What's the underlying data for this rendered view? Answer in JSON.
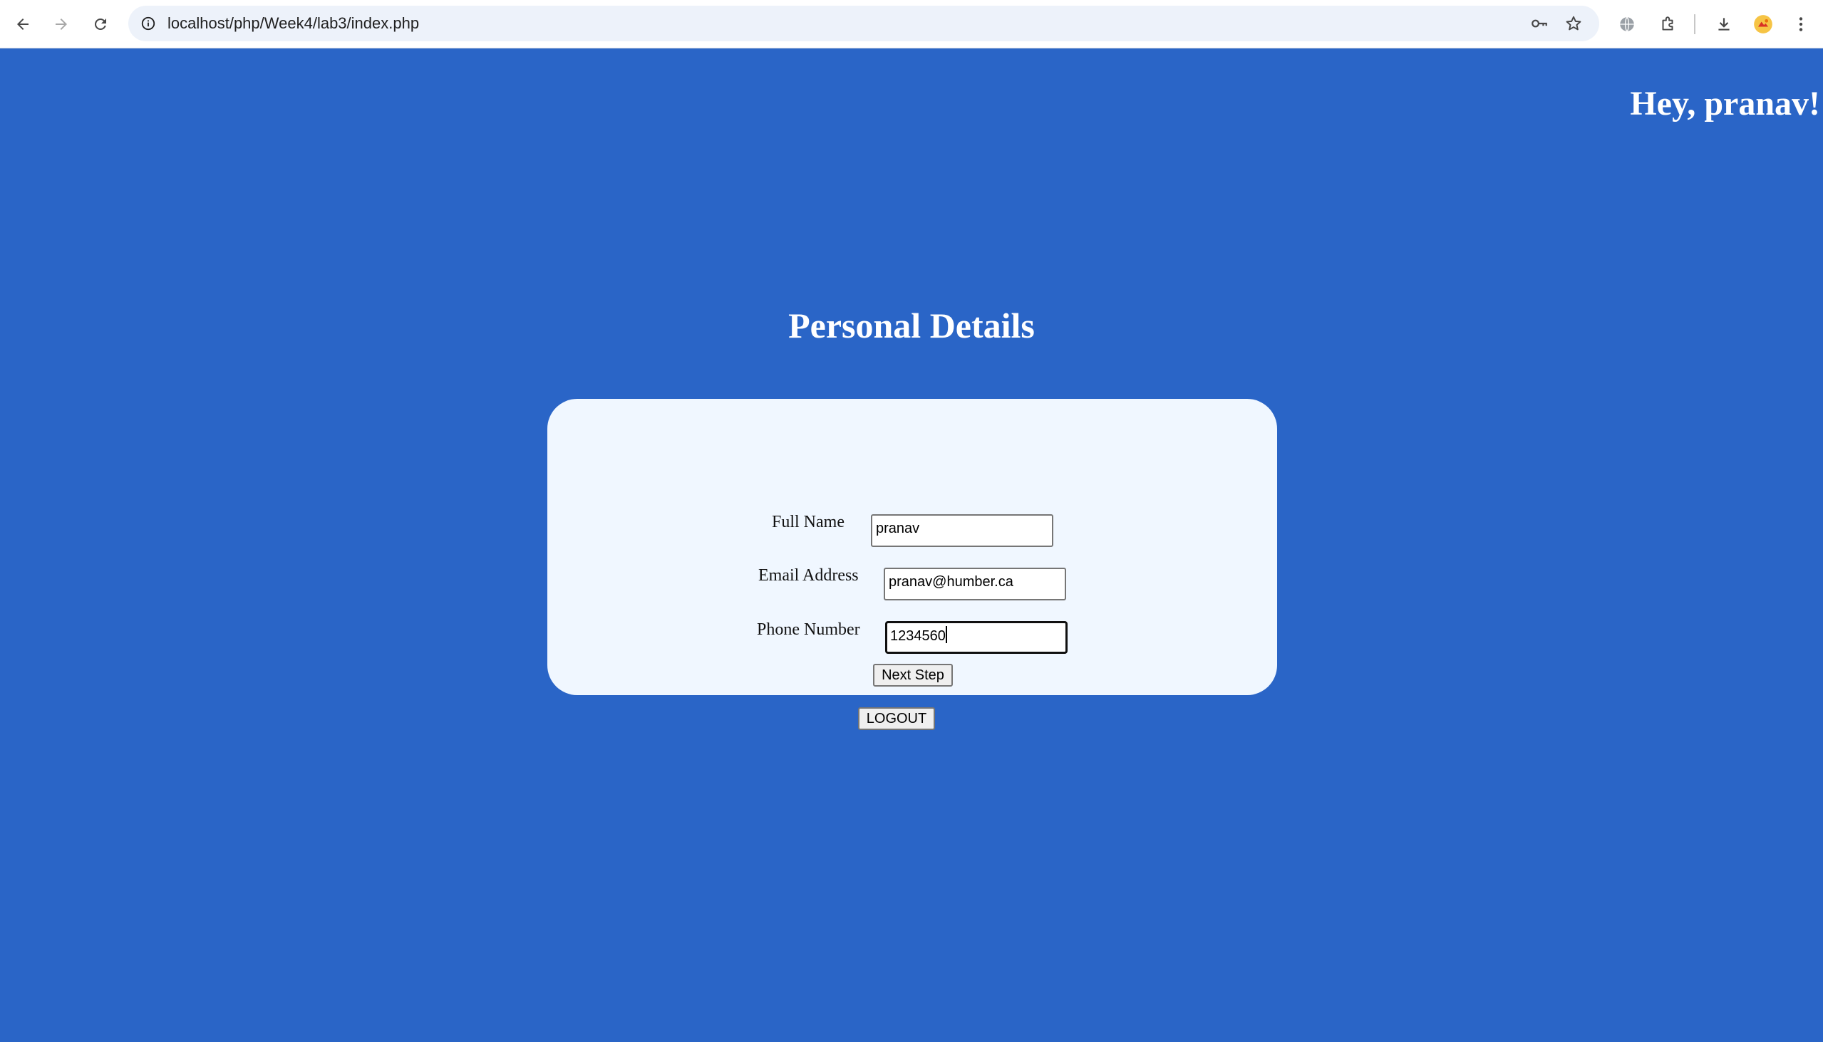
{
  "browser": {
    "url": "localhost/php/Week4/lab3/index.php",
    "icons": {
      "back": "back-arrow-icon",
      "forward": "forward-arrow-icon",
      "reload": "reload-icon",
      "site_info": "info-icon",
      "password": "key-icon",
      "bookmark": "star-icon",
      "translate": "globe-icon",
      "extensions": "puzzle-icon",
      "downloads": "download-icon",
      "profile": "profile-avatar-icon",
      "menu": "kebab-menu-icon"
    }
  },
  "page": {
    "background_color": "#2a65c7",
    "greeting": "Hey, pranav!",
    "title": "Personal Details",
    "form": {
      "full_name_label": "Full Name",
      "full_name_value": "pranav",
      "email_label": "Email Address",
      "email_value": "pranav@humber.ca",
      "phone_label": "Phone Number",
      "phone_value": "1234560",
      "submit_label": "Next Step"
    },
    "logout_label": "LOGOUT"
  }
}
